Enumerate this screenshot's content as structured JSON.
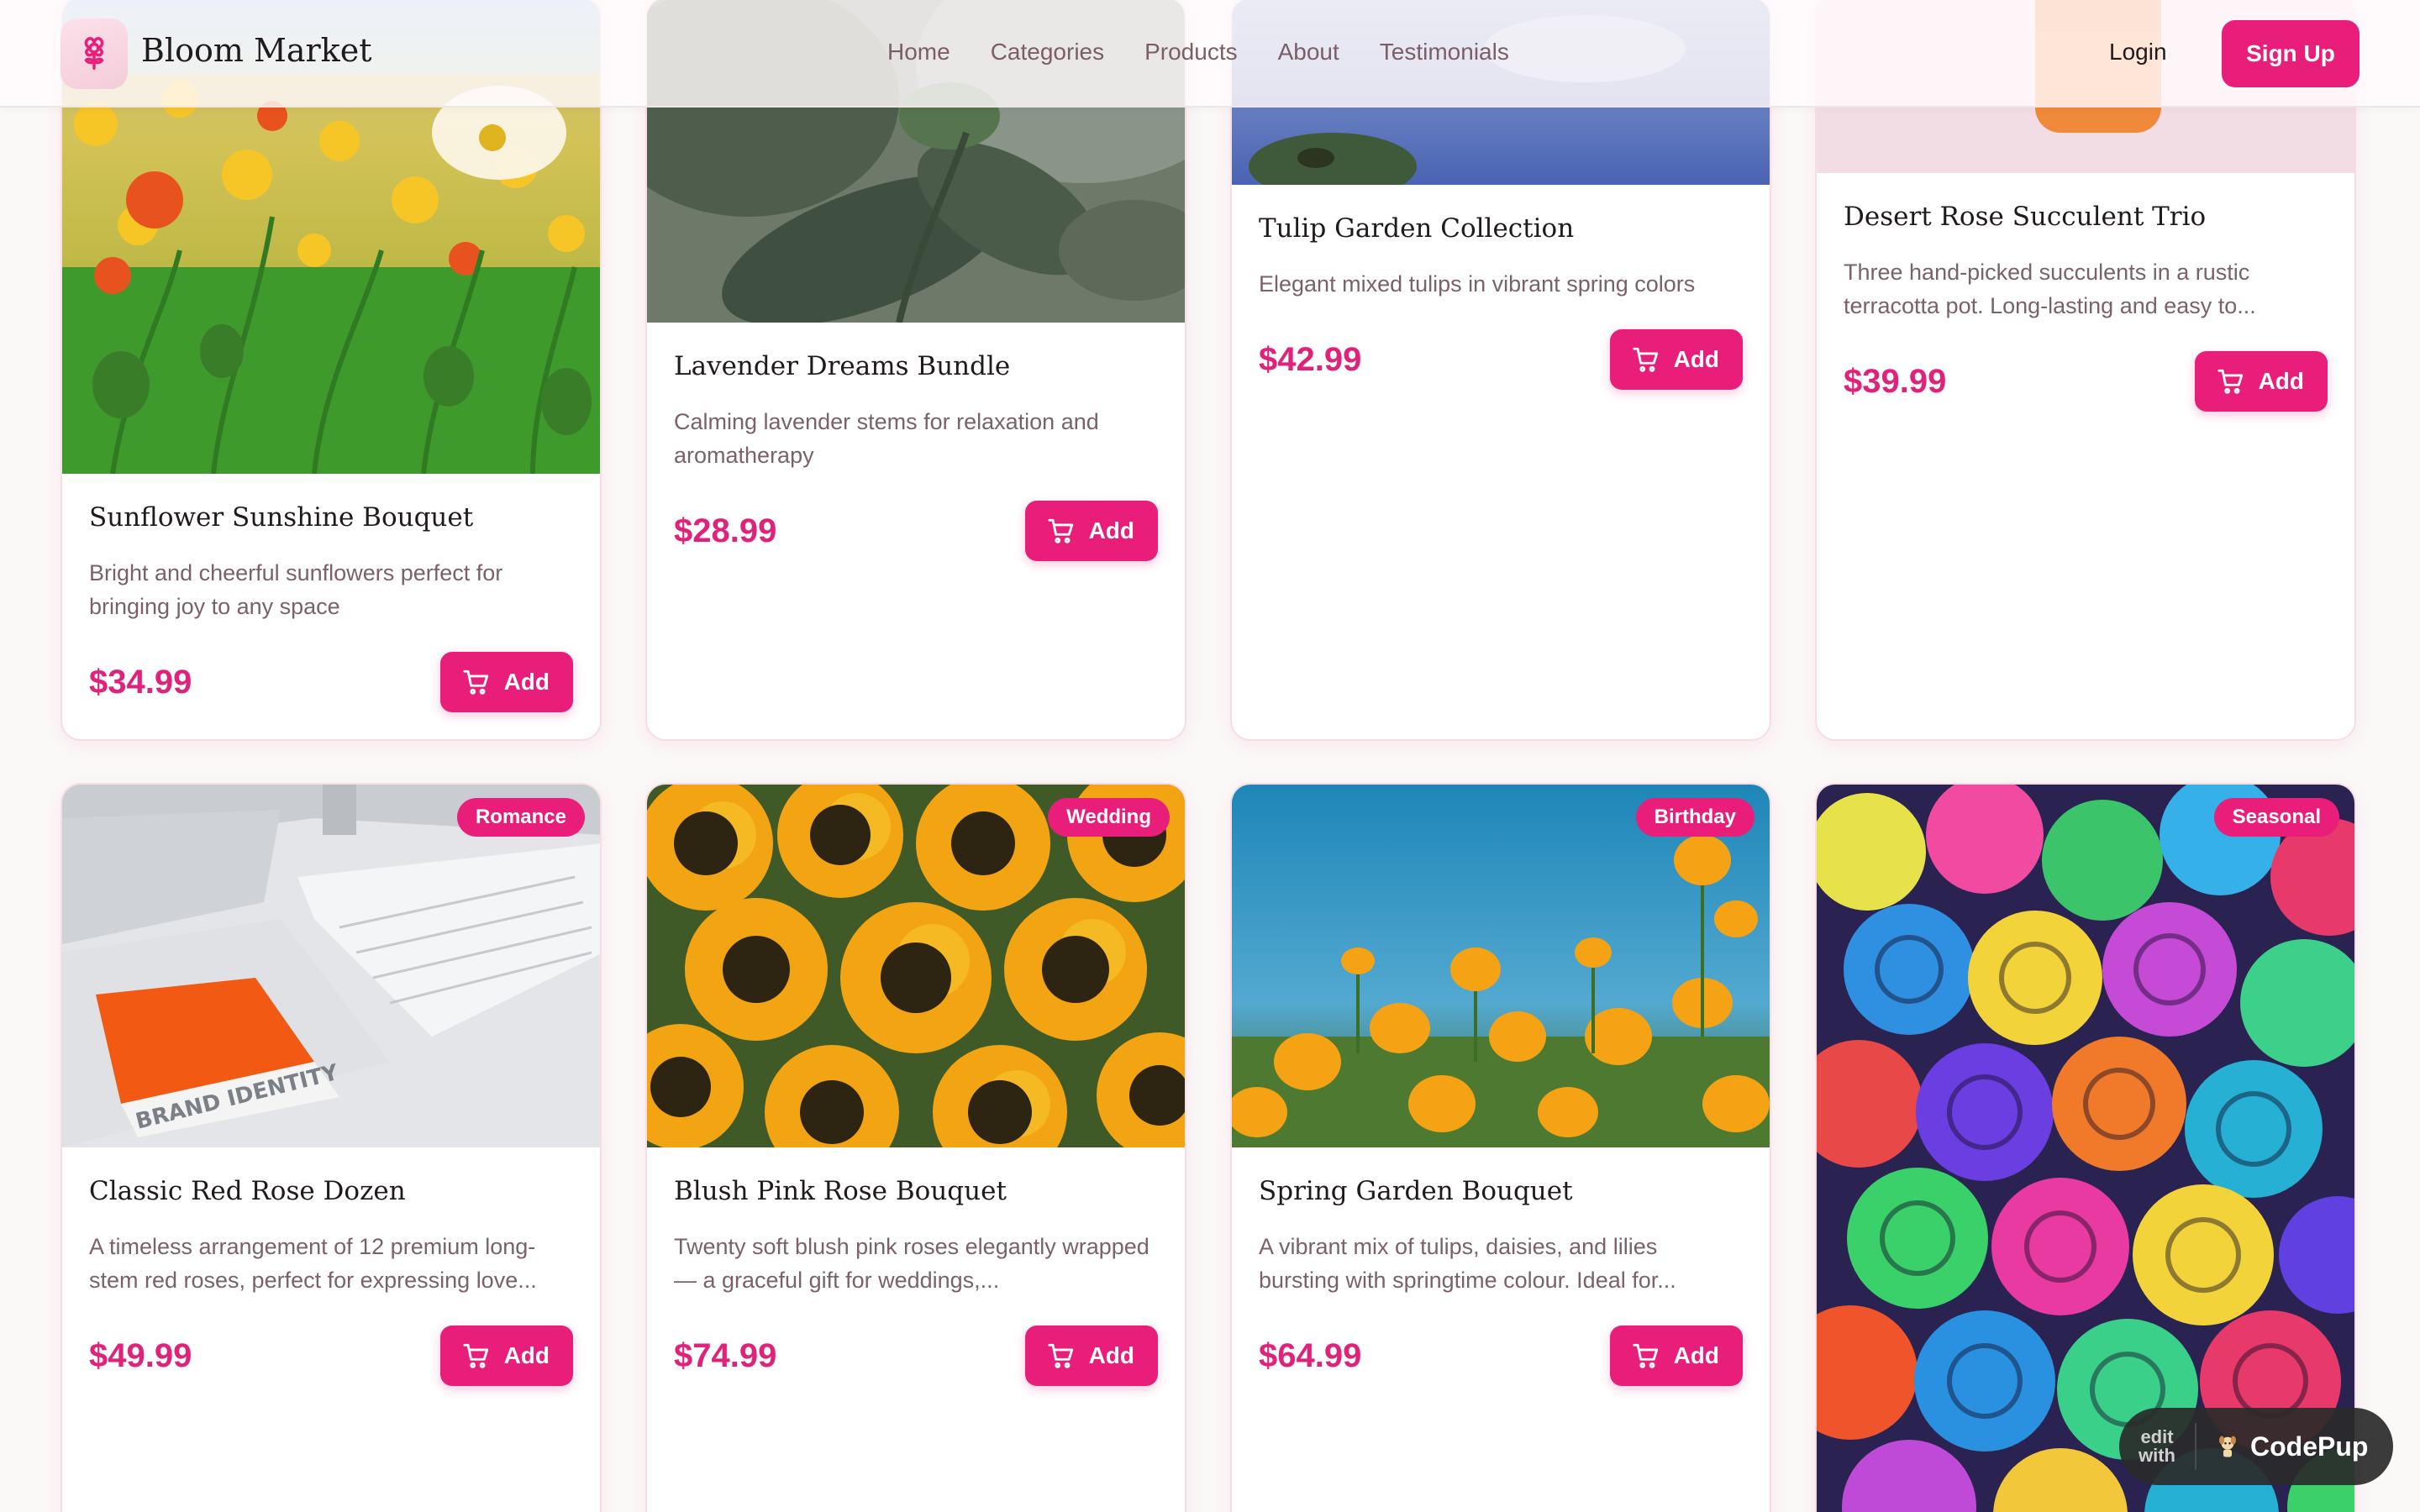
{
  "header": {
    "brand": "Bloom Market",
    "nav": [
      "Home",
      "Categories",
      "Products",
      "About",
      "Testimonials"
    ],
    "login_label": "Login",
    "signup_label": "Sign Up"
  },
  "products": [
    {
      "title": "Sunflower Sunshine Bouquet",
      "description": "Bright and cheerful sunflowers perfect for bringing joy to any space",
      "price": "$34.99",
      "add_label": "Add",
      "tag": ""
    },
    {
      "title": "Lavender Dreams Bundle",
      "description": "Calming lavender stems for relaxation and aromatherapy",
      "price": "$28.99",
      "add_label": "Add",
      "tag": ""
    },
    {
      "title": "Tulip Garden Collection",
      "description": "Elegant mixed tulips in vibrant spring colors",
      "price": "$42.99",
      "add_label": "Add",
      "tag": ""
    },
    {
      "title": "Desert Rose Succulent Trio",
      "description": "Three hand-picked succulents in a rustic terracotta pot. Long-lasting and easy to...",
      "price": "$39.99",
      "add_label": "Add",
      "tag": ""
    },
    {
      "title": "Classic Red Rose Dozen",
      "description": "A timeless arrangement of 12 premium long-stem red roses, perfect for expressing love...",
      "price": "$49.99",
      "add_label": "Add",
      "tag": "Romance"
    },
    {
      "title": "Blush Pink Rose Bouquet",
      "description": "Twenty soft blush pink roses elegantly wrapped — a graceful gift for weddings,...",
      "price": "$74.99",
      "add_label": "Add",
      "tag": "Wedding"
    },
    {
      "title": "Spring Garden Bouquet",
      "description": "A vibrant mix of tulips, daisies, and lilies bursting with springtime colour. Ideal for...",
      "price": "$64.99",
      "add_label": "Add",
      "tag": "Birthday"
    },
    {
      "tag": "Seasonal"
    }
  ],
  "product_image_art": "poppy-field-photo, lavender-leaves-photo, tulip-garden-photo, succulent-pot-photo, laptop-keyboard-photo, sunflowers-photo, orange-poppies-photo, rainbow-roses-photo",
  "badge": {
    "edit_line1": "edit",
    "edit_line2": "with",
    "brand": "CodePup"
  },
  "colors": {
    "accent": "#e91e7a",
    "price": "#e0237a",
    "text": "#1f1a1c",
    "muted": "#7a6268",
    "background": "#fbf8f8"
  }
}
